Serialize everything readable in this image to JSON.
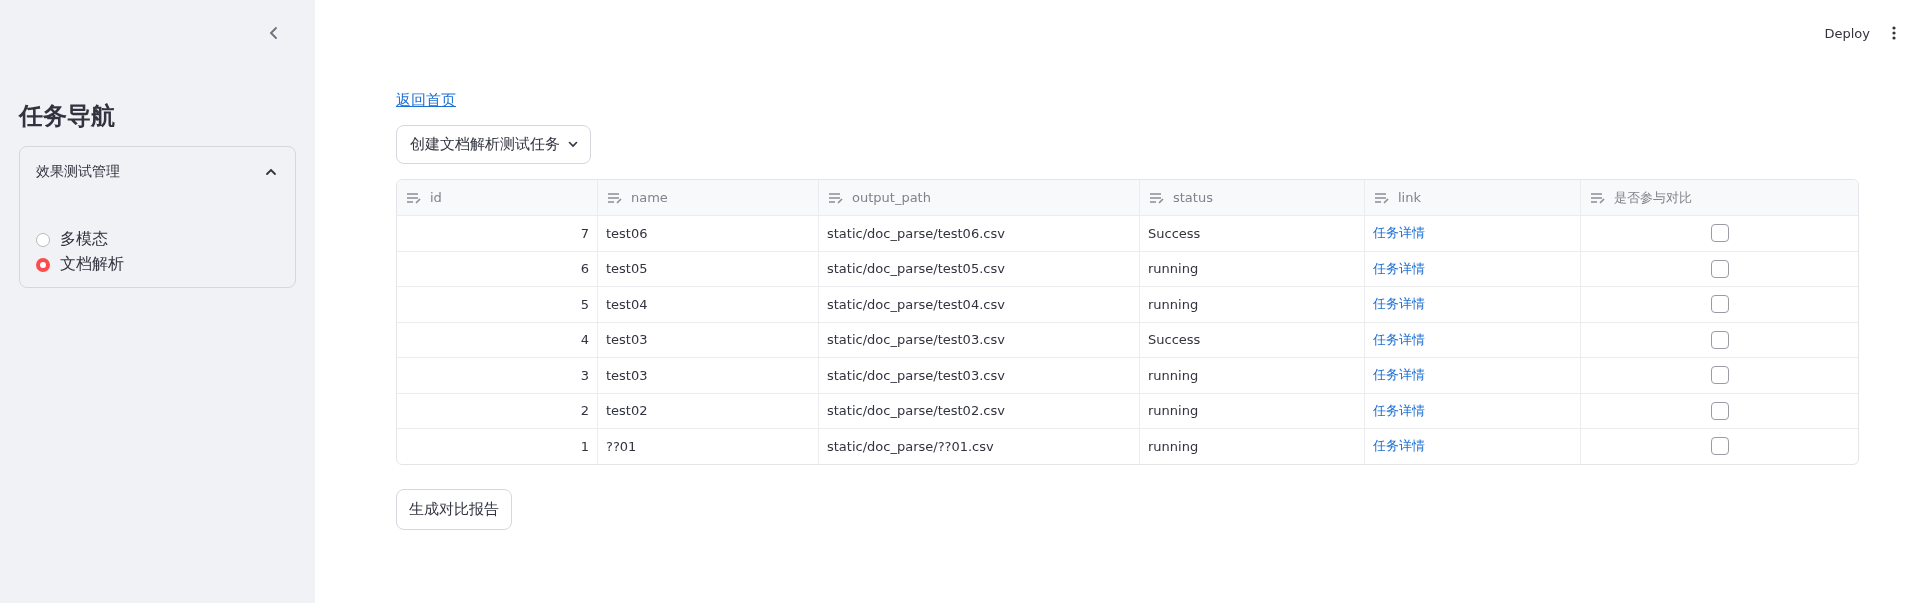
{
  "sidebar": {
    "title": "任务导航",
    "expander": {
      "label": "效果测试管理",
      "expanded": true,
      "options": [
        {
          "label": "多模态",
          "selected": false
        },
        {
          "label": "文档解析",
          "selected": true
        }
      ]
    }
  },
  "header": {
    "deploy": "Deploy"
  },
  "back_link": "返回首页",
  "dropdown": {
    "label": "创建文档解析测试任务"
  },
  "table": {
    "columns": [
      "id",
      "name",
      "output_path",
      "status",
      "link",
      "是否参与对比"
    ],
    "rows": [
      {
        "id": "7",
        "name": "test06",
        "output_path": "static/doc_parse/test06.csv",
        "status": "Success",
        "link": "任务详情",
        "checked": false
      },
      {
        "id": "6",
        "name": "test05",
        "output_path": "static/doc_parse/test05.csv",
        "status": "running",
        "link": "任务详情",
        "checked": false
      },
      {
        "id": "5",
        "name": "test04",
        "output_path": "static/doc_parse/test04.csv",
        "status": "running",
        "link": "任务详情",
        "checked": false
      },
      {
        "id": "4",
        "name": "test03",
        "output_path": "static/doc_parse/test03.csv",
        "status": "Success",
        "link": "任务详情",
        "checked": false
      },
      {
        "id": "3",
        "name": "test03",
        "output_path": "static/doc_parse/test03.csv",
        "status": "running",
        "link": "任务详情",
        "checked": false
      },
      {
        "id": "2",
        "name": "test02",
        "output_path": "static/doc_parse/test02.csv",
        "status": "running",
        "link": "任务详情",
        "checked": false
      },
      {
        "id": "1",
        "name": "??01",
        "output_path": "static/doc_parse/??01.csv",
        "status": "running",
        "link": "任务详情",
        "checked": false
      }
    ]
  },
  "report_button": "生成对比报告"
}
